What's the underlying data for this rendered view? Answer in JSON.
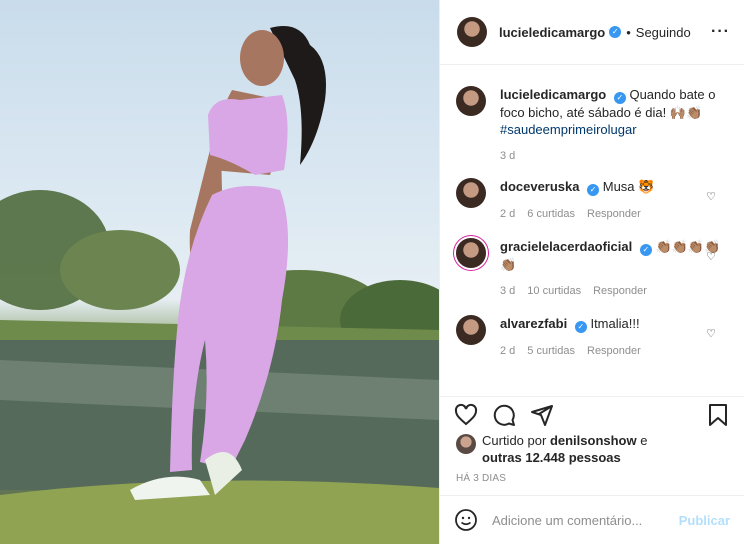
{
  "post": {
    "image_alt": "Mulher com roupa de ginástica rosa estampada em frente a um lago",
    "author": "lucieledicamargo",
    "follow_status": "Seguindo",
    "separator": "•"
  },
  "caption": {
    "username": "lucieledicamargo",
    "text": "Quando bate o foco bicho, até sábado é dia! 🙌🏽👏🏽",
    "hashtag": "#saudeemprimeirolugar",
    "age": "3 d"
  },
  "comments": [
    {
      "username": "doceveruska",
      "text": "Musa 🐯",
      "age": "2 d",
      "likes": "6 curtidas",
      "reply": "Responder"
    },
    {
      "username": "gracielelacerdaoficial",
      "text": "👏🏽👏🏽👏🏽👏🏽👏🏽",
      "age": "3 d",
      "likes": "10 curtidas",
      "reply": "Responder"
    },
    {
      "username": "alvarezfabi",
      "text": "Itmalia!!!",
      "age": "2 d",
      "likes": "5 curtidas",
      "reply": "Responder"
    }
  ],
  "likes": {
    "liked_by_prefix": "Curtido por",
    "liked_by_user": "denilsonshow",
    "and": "e",
    "others": "outras 12.448 pessoas"
  },
  "timestamp": "HÁ 3 DIAS",
  "add_comment": {
    "placeholder": "Adicione um comentário...",
    "publish": "Publicar"
  },
  "colors": {
    "verified": "#3897f0",
    "publish_disabled": "#b2dffc",
    "hashtag": "#00376b",
    "legging": "#d9a6e6"
  }
}
